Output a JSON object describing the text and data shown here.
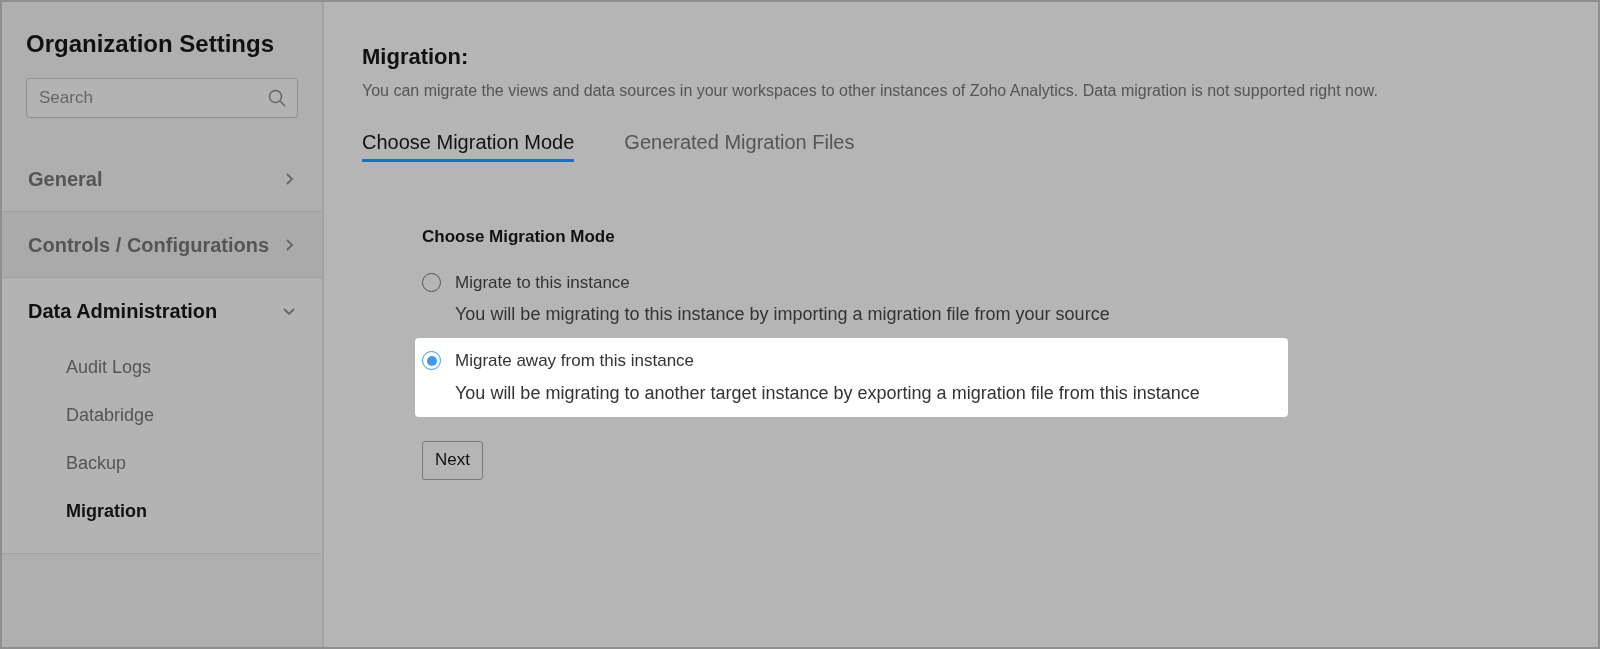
{
  "sidebar": {
    "title": "Organization Settings",
    "search": {
      "placeholder": "Search"
    },
    "sections": [
      {
        "label": "General",
        "expanded": false
      },
      {
        "label": "Controls / Configurations",
        "expanded": false
      },
      {
        "label": "Data Administration",
        "expanded": true,
        "children": [
          {
            "label": "Audit Logs",
            "selected": false
          },
          {
            "label": "Databridge",
            "selected": false
          },
          {
            "label": "Backup",
            "selected": false
          },
          {
            "label": "Migration",
            "selected": true
          }
        ]
      }
    ]
  },
  "main": {
    "title": "Migration:",
    "description": "You can migrate the views and data sources in your workspaces to other instances of Zoho Analytics. Data migration is not supported right now.",
    "tabs": [
      {
        "label": "Choose Migration Mode",
        "selected": true
      },
      {
        "label": "Generated Migration Files",
        "selected": false
      }
    ],
    "form": {
      "heading": "Choose Migration Mode",
      "options": [
        {
          "label": "Migrate to this instance",
          "description": "You will be migrating to this instance by importing a migration file from your source",
          "selected": false
        },
        {
          "label": "Migrate away from this instance",
          "description": "You will be migrating to another target instance by exporting a migration file from this instance",
          "selected": true
        }
      ],
      "button": "Next"
    }
  }
}
